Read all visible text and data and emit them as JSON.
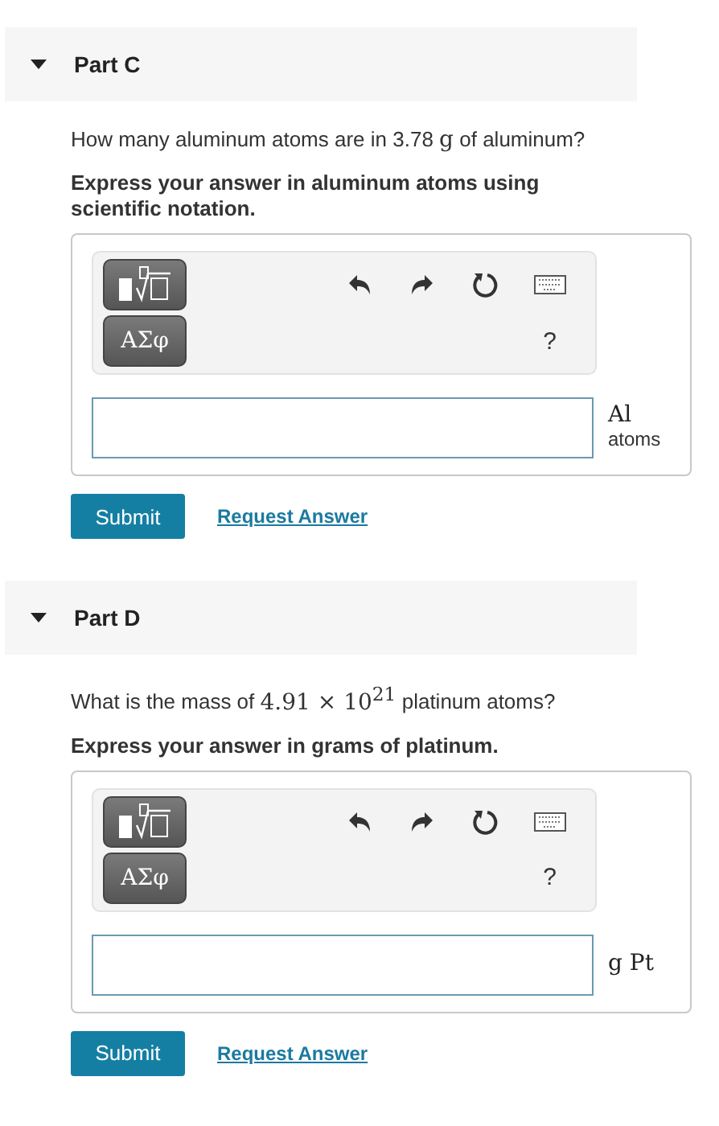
{
  "parts": [
    {
      "title": "Part C",
      "expanded": true,
      "question": [
        {
          "kind": "text",
          "text": "How many aluminum atoms are in 3.78 "
        },
        {
          "kind": "math",
          "text": "g"
        },
        {
          "kind": "text",
          "text": " of aluminum?"
        }
      ],
      "instruction": "Express your answer in aluminum atoms using scientific notation.",
      "symbols_button": "ΑΣφ",
      "help": "?",
      "unit": [
        {
          "kind": "math",
          "text": "Al"
        },
        {
          "kind": "text",
          "text": "atoms"
        }
      ],
      "submit": "Submit",
      "request": "Request Answer"
    },
    {
      "title": "Part D",
      "expanded": true,
      "question": [
        {
          "kind": "text",
          "text": "What is the mass of "
        },
        {
          "kind": "math",
          "text": "4.91 × 10$^{21}$"
        },
        {
          "kind": "text",
          "text": " platinum atoms?"
        }
      ],
      "instruction": "Express your answer in grams of platinum.",
      "symbols_button": "ΑΣφ",
      "help": "?",
      "unit": [
        {
          "kind": "math",
          "text": "g Pt"
        }
      ],
      "submit": "Submit",
      "request": "Request Answer"
    }
  ]
}
